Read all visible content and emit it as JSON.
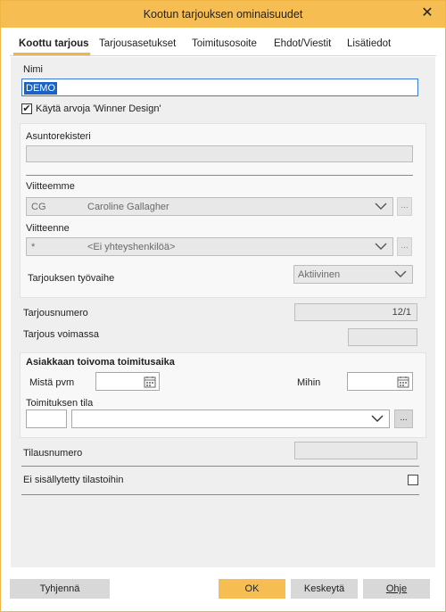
{
  "window": {
    "title": "Kootun tarjouksen ominaisuudet",
    "close_label": "✕"
  },
  "tabs": [
    {
      "label": "Koottu tarjous",
      "active": true
    },
    {
      "label": "Tarjousasetukset"
    },
    {
      "label": "Toimitusosoite"
    },
    {
      "label": "Ehdot/Viestit"
    },
    {
      "label": "Lisätiedot"
    }
  ],
  "form": {
    "name_label": "Nimi",
    "name_value": "DEMO",
    "use_values_label": "Käytä arvoja 'Winner Design'",
    "use_values_checked": "✔",
    "apartment_register_label": "Asuntorekisteri",
    "apartment_register_value": "",
    "our_ref_label": "Viitteemme",
    "our_ref_code": "CG",
    "our_ref_name": "Caroline Gallagher",
    "your_ref_label": "Viitteenne",
    "your_ref_code": "*",
    "your_ref_name": "<Ei yhteyshenkilöä>",
    "phase_label": "Tarjouksen työvaihe",
    "phase_value": "Aktiivinen",
    "offer_number_label": "Tarjousnumero",
    "offer_number_value": "12/1",
    "valid_label": "Tarjous voimassa",
    "valid_value": "",
    "delivery_heading": "Asiakkaan toivoma toimitusaika",
    "from_date_label": "Mistä pvm",
    "to_date_label": "Mihin",
    "delivery_status_label": "Toimituksen tila",
    "order_number_label": "Tilausnumero",
    "order_number_value": "",
    "exclude_stats_label": "Ei sisällytetty tilastoihin",
    "more_label": "..."
  },
  "buttons": {
    "clear": "Tyhjennä",
    "ok": "OK",
    "cancel": "Keskeytä",
    "help": "Ohje"
  },
  "colors": {
    "accent": "#f6bd52",
    "selection": "#1b62c5"
  }
}
